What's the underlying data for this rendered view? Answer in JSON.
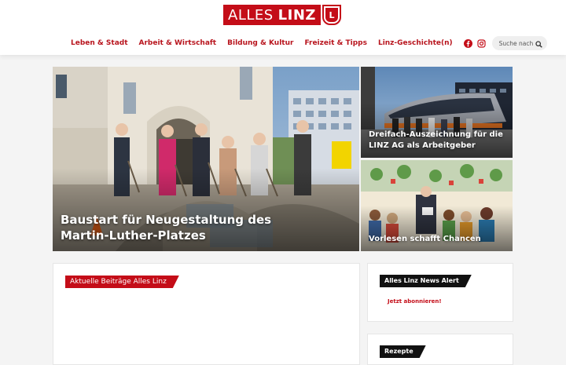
{
  "logo": {
    "word1": "ALLES",
    "word2": "LINZ",
    "crest": "L"
  },
  "nav": {
    "items": [
      {
        "label": "Leben & Stadt"
      },
      {
        "label": "Arbeit & Wirtschaft"
      },
      {
        "label": "Bildung & Kultur"
      },
      {
        "label": "Freizeit & Tipps"
      },
      {
        "label": "Linz-Geschichte(n)"
      }
    ],
    "social_icons": [
      "facebook-icon",
      "instagram-icon"
    ],
    "search_placeholder": "Suche nach"
  },
  "hero": {
    "main_title": "Baustart für Neugestaltung des Martin-Luther-Platzes",
    "side1_title": "Dreifach-Auszeichnung für die LINZ AG als Arbeitgeber",
    "side2_title": "Vorlesen schafft Chancen"
  },
  "sections": {
    "latest": "Aktuelle Beiträge Alles Linz",
    "news_alert": "Alles Linz News Alert",
    "subscribe": "Jetzt abonnieren!",
    "recipes": "Rezepte"
  },
  "colors": {
    "brand": "#c40d18",
    "nav": "#b8141d",
    "dark_tag": "#111111"
  }
}
